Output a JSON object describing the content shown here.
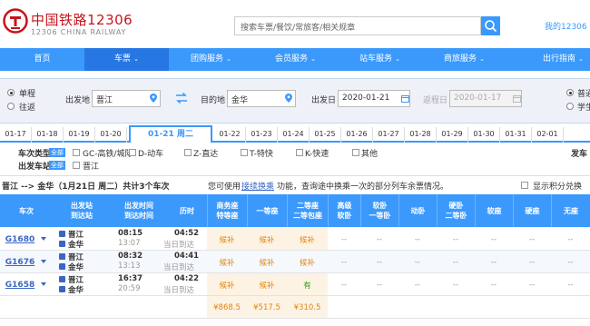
{
  "header": {
    "brand_cn": "中国铁路12306",
    "brand_en": "12306 CHINA RAILWAY",
    "search_placeholder": "搜索车票/餐饮/常旅客/相关规章",
    "my_link": "我的12306",
    "brand_color": "#c6151b"
  },
  "nav": {
    "items": [
      {
        "label": "首页",
        "caret": ""
      },
      {
        "label": "车票",
        "caret": "⌄"
      },
      {
        "label": "团购服务",
        "caret": "⌄"
      },
      {
        "label": "会员服务",
        "caret": "⌄"
      },
      {
        "label": "站车服务",
        "caret": "⌄"
      },
      {
        "label": "商旅服务",
        "caret": "⌄"
      },
      {
        "label": "出行指南",
        "caret": "⌄"
      }
    ],
    "active_index": 1,
    "color": "#3b99fc"
  },
  "query": {
    "trip_single": "单程",
    "trip_return": "往返",
    "from_label": "出发地",
    "from_value": "晋江",
    "to_label": "目的地",
    "to_value": "金华",
    "depart_label": "出发日",
    "depart_value": "2020-01-21",
    "return_label": "返程日",
    "return_value": "2020-01-17",
    "type_normal": "普通",
    "type_student": "学生"
  },
  "dates": {
    "tabs": [
      "01-17",
      "01-18",
      "01-19",
      "01-20",
      "01-21 周二",
      "01-22",
      "01-23",
      "01-24",
      "01-25",
      "01-26",
      "01-27",
      "01-28",
      "01-29",
      "01-30",
      "01-31",
      "02-01"
    ],
    "active_index": 4
  },
  "filter": {
    "type_label": "车次类型:",
    "station_label": "出发车站:",
    "all_tag": "全部",
    "types": [
      "GC-高铁/城际",
      "D-动车",
      "Z-直达",
      "T-特快",
      "K-快速",
      "其他"
    ],
    "stations": [
      "晋江"
    ],
    "depart_time_label": "发车"
  },
  "info": {
    "route": "晋江 --> 金华（1月21日 周二）共计3个车次",
    "hint_prefix": "您可使用",
    "hint_link": "接续换乘",
    "hint_suffix": "功能，查询途中换乘一次的部分列车余票情况。",
    "points_label": "显示积分兑换"
  },
  "table": {
    "headers": {
      "train": "车次",
      "stations": [
        "出发站",
        "到达站"
      ],
      "times": [
        "出发时间",
        "到达时间"
      ],
      "duration": "历时",
      "business": [
        "商务座",
        "特等座"
      ],
      "first": "一等座",
      "second": [
        "二等座",
        "二等包座"
      ],
      "soft_premium": [
        "高级",
        "软卧"
      ],
      "soft_sleeper1": [
        "软卧",
        "一等卧"
      ],
      "dynamic": "动卧",
      "hard_sleeper": [
        "硬卧",
        "二等卧"
      ],
      "soft_seat": "软座",
      "hard_seat": "硬座",
      "no_seat": "无座"
    },
    "rows": [
      {
        "train": "G1680",
        "from": "晋江",
        "to": "金华",
        "depart": "08:15",
        "arrive": "13:07",
        "duration": "04:52",
        "arrive_note": "当日到达",
        "business": "候补",
        "first": "候补",
        "second": "候补",
        "soft_premium": "--",
        "soft_sleeper1": "--",
        "dynamic": "--",
        "hard_sleeper": "--",
        "soft_seat": "--",
        "hard_seat": "--",
        "no_seat": "--"
      },
      {
        "train": "G1676",
        "from": "晋江",
        "to": "金华",
        "depart": "08:32",
        "arrive": "13:13",
        "duration": "04:41",
        "arrive_note": "当日到达",
        "business": "候补",
        "first": "候补",
        "second": "候补",
        "soft_premium": "--",
        "soft_sleeper1": "--",
        "dynamic": "--",
        "hard_sleeper": "--",
        "soft_seat": "--",
        "hard_seat": "--",
        "no_seat": "--"
      },
      {
        "train": "G1658",
        "from": "晋江",
        "to": "金华",
        "depart": "16:37",
        "arrive": "20:59",
        "duration": "04:22",
        "arrive_note": "当日到达",
        "business": "候补",
        "first": "候补",
        "second": "有",
        "soft_premium": "--",
        "soft_sleeper1": "--",
        "dynamic": "--",
        "hard_sleeper": "--",
        "soft_seat": "--",
        "hard_seat": "--",
        "no_seat": "--"
      }
    ],
    "prices": {
      "business": "¥868.5",
      "first": "¥517.5",
      "second": "¥310.5"
    },
    "waitlist_color": "#e08510",
    "available_color": "#26a306"
  }
}
